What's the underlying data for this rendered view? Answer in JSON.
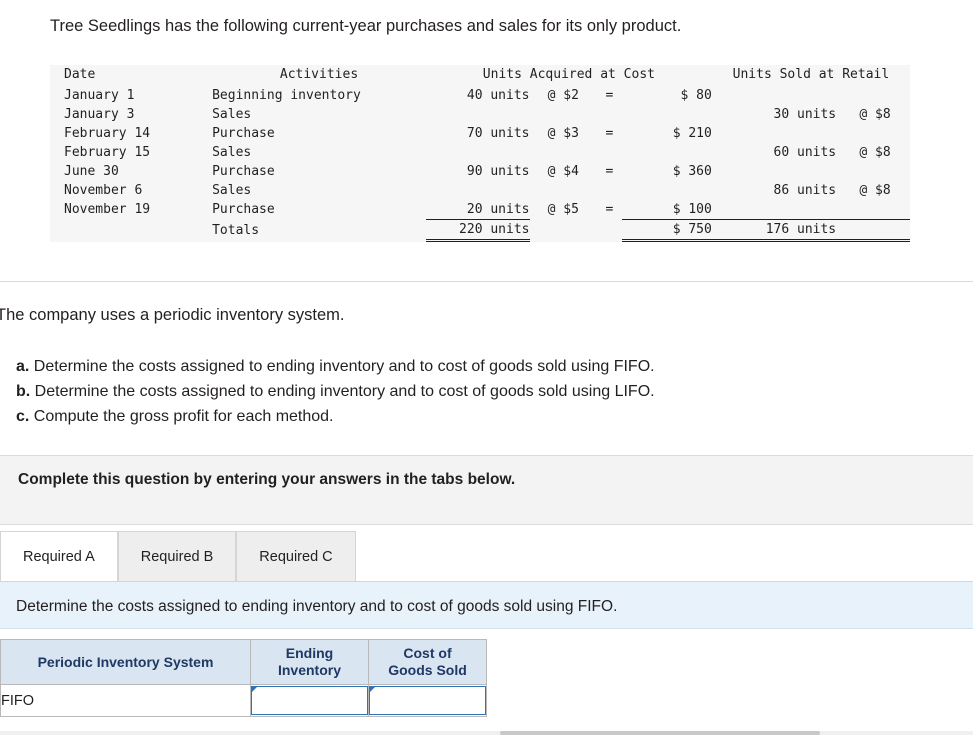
{
  "intro": "Tree Seedlings has the following current-year purchases and sales for its only product.",
  "table": {
    "headers": {
      "date": "Date",
      "activities": "Activities",
      "acquired": "Units Acquired at Cost",
      "sold": "Units Sold at Retail"
    },
    "rows": [
      {
        "date": "January  1",
        "activity": "Beginning inventory",
        "units": "40 units",
        "at": "@ $2",
        "eq": "=",
        "cost": "$  80",
        "sold": "",
        "retail": ""
      },
      {
        "date": "January  3",
        "activity": "Sales",
        "units": "",
        "at": "",
        "eq": "",
        "cost": "",
        "sold": "30 units",
        "retail": "@ $8"
      },
      {
        "date": "February 14",
        "activity": "Purchase",
        "units": "70 units",
        "at": "@ $3",
        "eq": "=",
        "cost": "$ 210",
        "sold": "",
        "retail": ""
      },
      {
        "date": "February 15",
        "activity": "Sales",
        "units": "",
        "at": "",
        "eq": "",
        "cost": "",
        "sold": "60 units",
        "retail": "@ $8"
      },
      {
        "date": "June 30",
        "activity": "Purchase",
        "units": "90 units",
        "at": "@ $4",
        "eq": "=",
        "cost": "$ 360",
        "sold": "",
        "retail": ""
      },
      {
        "date": "November  6",
        "activity": "Sales",
        "units": "",
        "at": "",
        "eq": "",
        "cost": "",
        "sold": "86 units",
        "retail": "@ $8"
      },
      {
        "date": "November 19",
        "activity": "Purchase",
        "units": "20 units",
        "at": "@ $5",
        "eq": "=",
        "cost": "$ 100",
        "sold": "",
        "retail": ""
      }
    ],
    "totals": {
      "date": "",
      "activity": "Totals",
      "units": "220 units",
      "at": "",
      "eq": "",
      "cost": "$ 750",
      "sold": "176 units",
      "retail": ""
    }
  },
  "periodic_note": "The company uses a periodic inventory system.",
  "requirements": [
    {
      "label": "a.",
      "text": " Determine the costs assigned to ending inventory and to cost of goods sold using FIFO."
    },
    {
      "label": "b.",
      "text": " Determine the costs assigned to ending inventory and to cost of goods sold using LIFO."
    },
    {
      "label": "c.",
      "text": " Compute the gross profit for each method."
    }
  ],
  "complete_text": "Complete this question by entering your answers in the tabs below.",
  "tabs": [
    {
      "label": "Required A",
      "active": true
    },
    {
      "label": "Required B",
      "active": false
    },
    {
      "label": "Required C",
      "active": false
    }
  ],
  "instruction": "Determine the costs assigned to ending inventory and to cost of goods sold using FIFO.",
  "answer_table": {
    "header_left": "Periodic Inventory System",
    "header_col1_line1": "Ending",
    "header_col1_line2": "Inventory",
    "header_col2_line1": "Cost of",
    "header_col2_line2": "Goods Sold",
    "rows": [
      {
        "label": "FIFO",
        "ending_inventory": "",
        "cogs": ""
      }
    ]
  },
  "colors": {
    "header_blue": "#d9e6f2",
    "header_text": "#1f3864",
    "input_border": "#2e74b5",
    "instruction_band": "#e8f2fa",
    "complete_band": "#f3f3f3"
  }
}
